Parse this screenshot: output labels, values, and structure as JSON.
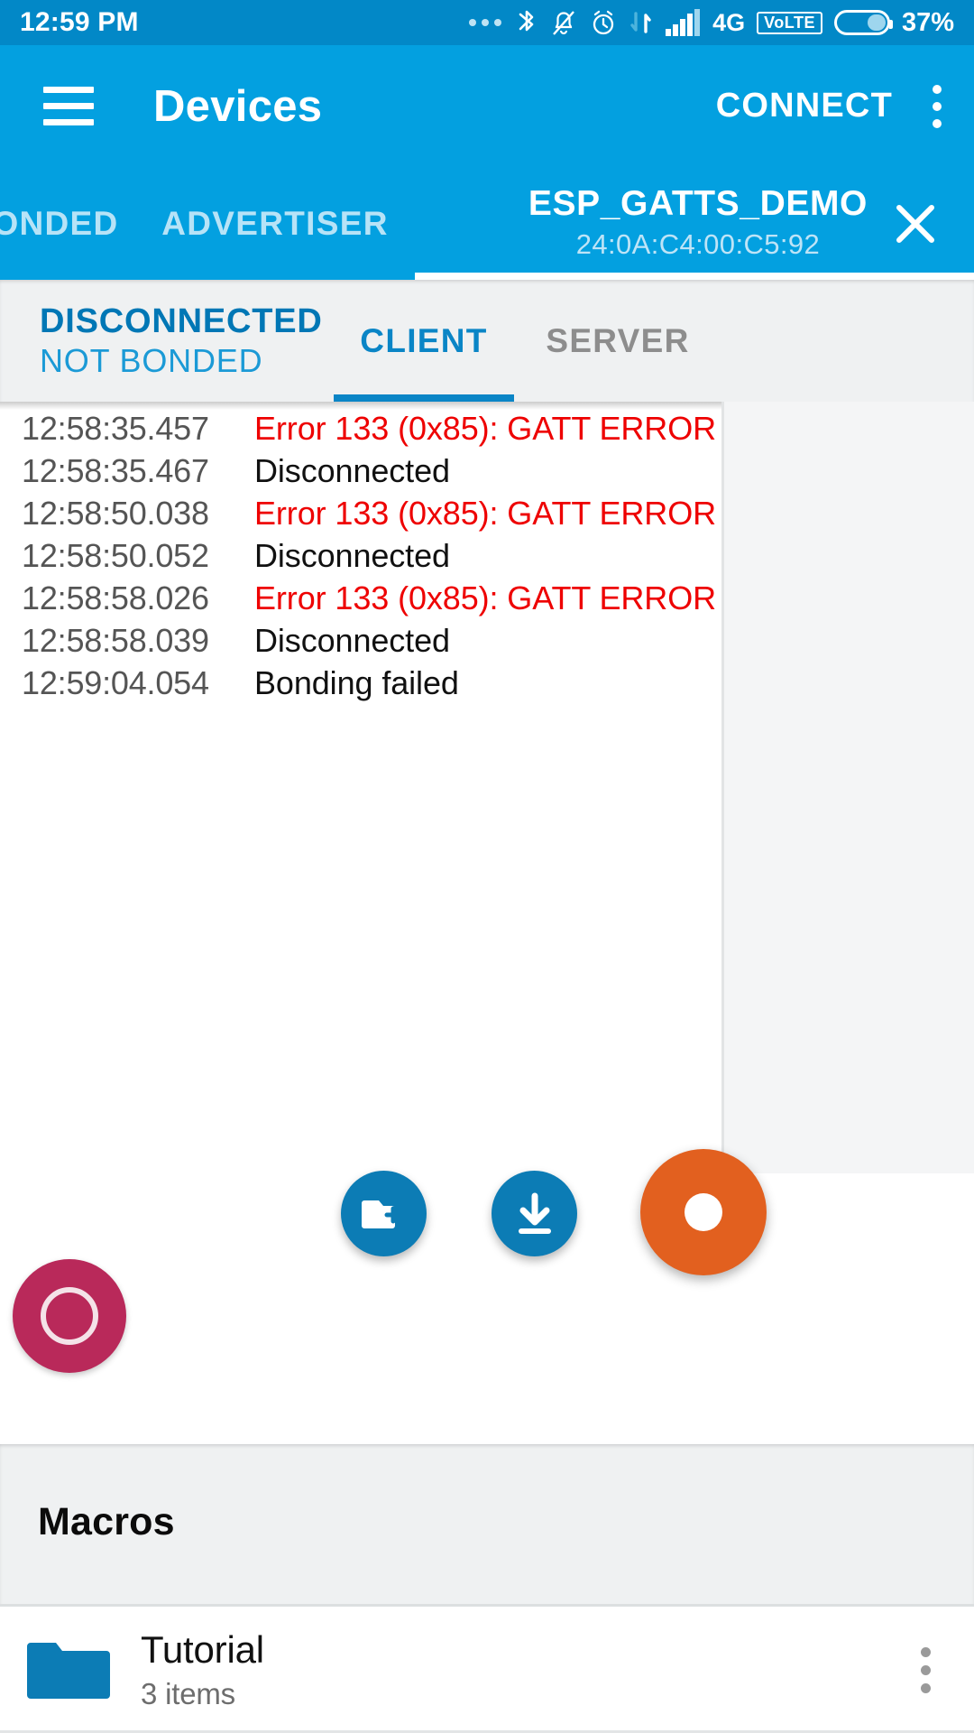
{
  "status_bar": {
    "clock": "12:59 PM",
    "network_type": "4G",
    "volte_label": "VoLTE",
    "battery_percent": "37%",
    "battery_level": 37,
    "icons": [
      "more-dots-icon",
      "bluetooth-icon",
      "bell-muted-icon",
      "alarm-clock-icon",
      "data-transfer-icon",
      "signal-bars-icon"
    ],
    "accent": "#0288c7"
  },
  "app_bar": {
    "menu_icon": "hamburger-menu-icon",
    "title": "Devices",
    "connect_label": "CONNECT",
    "overflow_icon": "kebab-menu-icon",
    "background": "#03a0e0"
  },
  "device_tabs": {
    "tabs": [
      {
        "label": "BONDED",
        "selected": false
      },
      {
        "label": "ADVERTISER",
        "selected": false
      }
    ],
    "active_device": {
      "name": "ESP_GATTS_DEMO",
      "address": "24:0A:C4:00:C5:92",
      "close_icon": "close-icon",
      "selected": true
    }
  },
  "connection_bar": {
    "state": "DISCONNECTED",
    "bond_state": "NOT BONDED",
    "state_color": "#0077b5",
    "bond_color": "#1b9ad6",
    "tabs": [
      {
        "label": "CLIENT",
        "selected": true
      },
      {
        "label": "SERVER",
        "selected": false
      }
    ],
    "indicator_color": "#0a85c6"
  },
  "log": {
    "error_color": "#ee0000",
    "entries": [
      {
        "time": "12:58:35.457",
        "message": "Error 133 (0x85): GATT ERROR",
        "level": "error"
      },
      {
        "time": "12:58:35.467",
        "message": "Disconnected",
        "level": "normal"
      },
      {
        "time": "12:58:50.038",
        "message": "Error 133 (0x85): GATT ERROR",
        "level": "error"
      },
      {
        "time": "12:58:50.052",
        "message": "Disconnected",
        "level": "normal"
      },
      {
        "time": "12:58:58.026",
        "message": "Error 133 (0x85): GATT ERROR",
        "level": "error"
      },
      {
        "time": "12:58:58.039",
        "message": "Disconnected",
        "level": "normal"
      },
      {
        "time": "12:59:04.054",
        "message": "Bonding failed",
        "level": "normal"
      }
    ]
  },
  "record_button": {
    "icon": "record-circle-icon",
    "color": "#b9295a"
  },
  "macros": {
    "title": "Macros",
    "buttons": [
      {
        "icon": "new-folder-icon",
        "color": "#0c7cb5"
      },
      {
        "icon": "import-download-icon",
        "color": "#0c7cb5"
      },
      {
        "icon": "record-icon",
        "color": "#e2601f"
      }
    ],
    "items": [
      {
        "icon": "folder-icon",
        "name": "Tutorial",
        "subtitle": "3 items",
        "overflow_icon": "kebab-menu-icon"
      }
    ]
  }
}
